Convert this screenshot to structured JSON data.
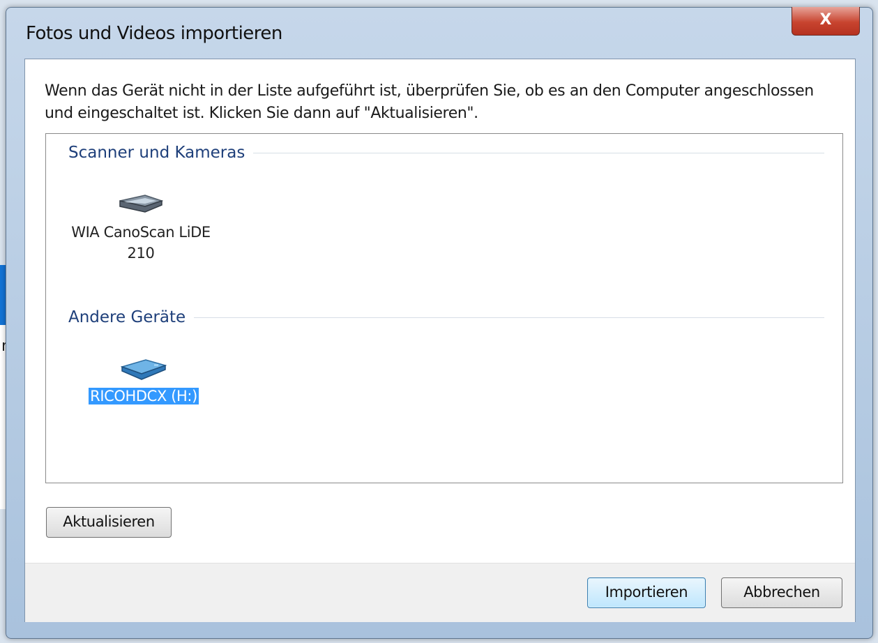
{
  "dialog": {
    "title": "Fotos und Videos importieren",
    "close_label": "X",
    "instructions": "Wenn das Gerät nicht in der Liste aufgeführt ist, überprüfen Sie, ob es an den Computer angeschlossen und eingeschaltet ist. Klicken Sie dann auf \"Aktualisieren\".",
    "groups": [
      {
        "header": "Scanner und Kameras",
        "devices": [
          {
            "label": "WIA CanoScan LiDE 210",
            "icon": "scanner-icon",
            "selected": false
          }
        ]
      },
      {
        "header": "Andere Geräte",
        "devices": [
          {
            "label": "RICOHDCX (H:)",
            "icon": "removable-drive-icon",
            "selected": true
          }
        ]
      }
    ],
    "refresh_label": "Aktualisieren",
    "import_label": "Importieren",
    "cancel_label": "Abbrechen"
  },
  "background_window": {
    "partial_text": "n",
    "icons": [
      "rotate-icon",
      "image-icon",
      "delete-icon"
    ]
  },
  "colors": {
    "selection": "#3399ff",
    "group_header": "#1e3f7a",
    "close_button": "#c8442f"
  }
}
